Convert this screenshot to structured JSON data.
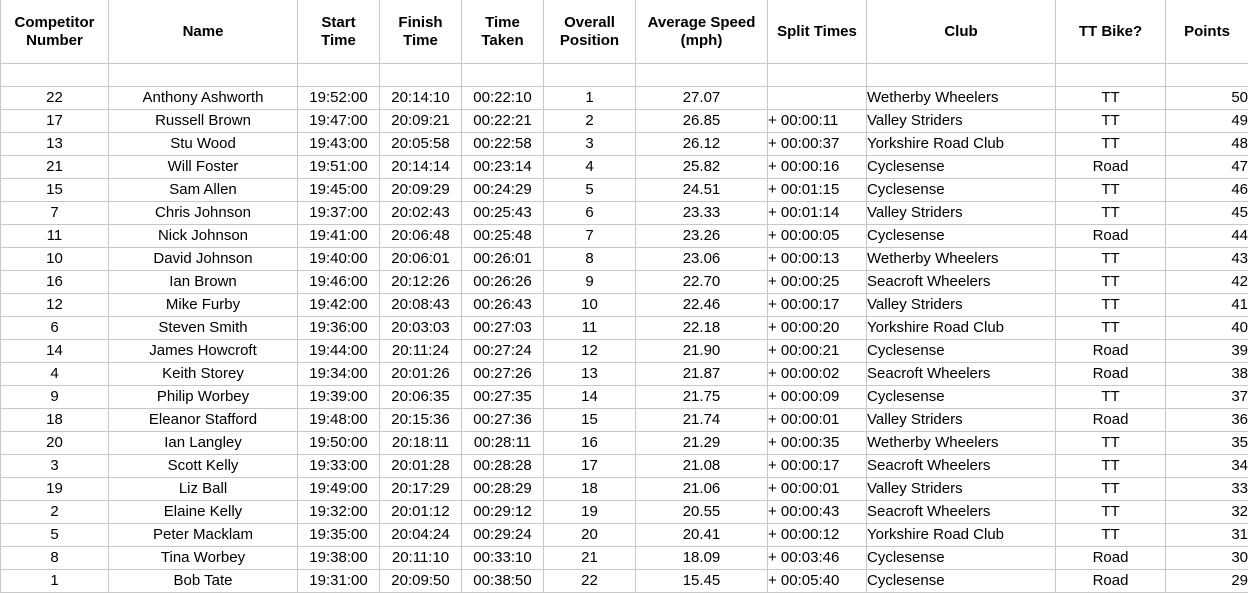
{
  "table": {
    "columns": [
      {
        "id": "competitor_number",
        "lines": [
          "Competitor",
          "Number"
        ]
      },
      {
        "id": "name",
        "lines": [
          "Name"
        ]
      },
      {
        "id": "start_time",
        "lines": [
          "Start",
          "Time"
        ]
      },
      {
        "id": "finish_time",
        "lines": [
          "Finish",
          "Time"
        ]
      },
      {
        "id": "time_taken",
        "lines": [
          "Time",
          "Taken"
        ]
      },
      {
        "id": "overall_position",
        "lines": [
          "Overall",
          "Position"
        ]
      },
      {
        "id": "average_speed",
        "lines": [
          "Average Speed",
          "(mph)"
        ]
      },
      {
        "id": "split_times",
        "lines": [
          "Split Times"
        ]
      },
      {
        "id": "club",
        "lines": [
          "Club"
        ]
      },
      {
        "id": "tt_bike",
        "lines": [
          "TT Bike?"
        ]
      },
      {
        "id": "points",
        "lines": [
          "Points"
        ]
      }
    ],
    "header": {
      "competitor_number_l1": "Competitor",
      "competitor_number_l2": "Number",
      "name": "Name",
      "start_time_l1": "Start",
      "start_time_l2": "Time",
      "finish_time_l1": "Finish",
      "finish_time_l2": "Time",
      "time_taken_l1": "Time",
      "time_taken_l2": "Taken",
      "overall_position_l1": "Overall",
      "overall_position_l2": "Position",
      "average_speed_l1": "Average Speed",
      "average_speed_l2": "(mph)",
      "split_times": "Split Times",
      "club": "Club",
      "tt_bike": "TT Bike?",
      "points": "Points"
    },
    "rows": [
      {
        "competitor_number": "22",
        "name": "Anthony Ashworth",
        "start_time": "19:52:00",
        "finish_time": "20:14:10",
        "time_taken": "00:22:10",
        "overall_position": "1",
        "average_speed": "27.07",
        "split_times": "",
        "club": "Wetherby Wheelers",
        "tt_bike": "TT",
        "points": "50"
      },
      {
        "competitor_number": "17",
        "name": "Russell Brown",
        "start_time": "19:47:00",
        "finish_time": "20:09:21",
        "time_taken": "00:22:21",
        "overall_position": "2",
        "average_speed": "26.85",
        "split_times": "+ 00:00:11",
        "club": "Valley Striders",
        "tt_bike": "TT",
        "points": "49"
      },
      {
        "competitor_number": "13",
        "name": "Stu Wood",
        "start_time": "19:43:00",
        "finish_time": "20:05:58",
        "time_taken": "00:22:58",
        "overall_position": "3",
        "average_speed": "26.12",
        "split_times": "+ 00:00:37",
        "club": "Yorkshire Road Club",
        "tt_bike": "TT",
        "points": "48"
      },
      {
        "competitor_number": "21",
        "name": "Will Foster",
        "start_time": "19:51:00",
        "finish_time": "20:14:14",
        "time_taken": "00:23:14",
        "overall_position": "4",
        "average_speed": "25.82",
        "split_times": "+ 00:00:16",
        "club": "Cyclesense",
        "tt_bike": "Road",
        "points": "47"
      },
      {
        "competitor_number": "15",
        "name": "Sam Allen",
        "start_time": "19:45:00",
        "finish_time": "20:09:29",
        "time_taken": "00:24:29",
        "overall_position": "5",
        "average_speed": "24.51",
        "split_times": "+ 00:01:15",
        "club": "Cyclesense",
        "tt_bike": "TT",
        "points": "46"
      },
      {
        "competitor_number": "7",
        "name": "Chris Johnson",
        "start_time": "19:37:00",
        "finish_time": "20:02:43",
        "time_taken": "00:25:43",
        "overall_position": "6",
        "average_speed": "23.33",
        "split_times": "+ 00:01:14",
        "club": "Valley Striders",
        "tt_bike": "TT",
        "points": "45"
      },
      {
        "competitor_number": "11",
        "name": "Nick Johnson",
        "start_time": "19:41:00",
        "finish_time": "20:06:48",
        "time_taken": "00:25:48",
        "overall_position": "7",
        "average_speed": "23.26",
        "split_times": "+ 00:00:05",
        "club": "Cyclesense",
        "tt_bike": "Road",
        "points": "44"
      },
      {
        "competitor_number": "10",
        "name": "David Johnson",
        "start_time": "19:40:00",
        "finish_time": "20:06:01",
        "time_taken": "00:26:01",
        "overall_position": "8",
        "average_speed": "23.06",
        "split_times": "+ 00:00:13",
        "club": "Wetherby Wheelers",
        "tt_bike": "TT",
        "points": "43"
      },
      {
        "competitor_number": "16",
        "name": "Ian Brown",
        "start_time": "19:46:00",
        "finish_time": "20:12:26",
        "time_taken": "00:26:26",
        "overall_position": "9",
        "average_speed": "22.70",
        "split_times": "+ 00:00:25",
        "club": "Seacroft Wheelers",
        "tt_bike": "TT",
        "points": "42"
      },
      {
        "competitor_number": "12",
        "name": "Mike Furby",
        "start_time": "19:42:00",
        "finish_time": "20:08:43",
        "time_taken": "00:26:43",
        "overall_position": "10",
        "average_speed": "22.46",
        "split_times": "+ 00:00:17",
        "club": "Valley Striders",
        "tt_bike": "TT",
        "points": "41"
      },
      {
        "competitor_number": "6",
        "name": "Steven Smith",
        "start_time": "19:36:00",
        "finish_time": "20:03:03",
        "time_taken": "00:27:03",
        "overall_position": "11",
        "average_speed": "22.18",
        "split_times": "+ 00:00:20",
        "club": "Yorkshire Road Club",
        "tt_bike": "TT",
        "points": "40"
      },
      {
        "competitor_number": "14",
        "name": "James Howcroft",
        "start_time": "19:44:00",
        "finish_time": "20:11:24",
        "time_taken": "00:27:24",
        "overall_position": "12",
        "average_speed": "21.90",
        "split_times": "+ 00:00:21",
        "club": "Cyclesense",
        "tt_bike": "Road",
        "points": "39"
      },
      {
        "competitor_number": "4",
        "name": "Keith Storey",
        "start_time": "19:34:00",
        "finish_time": "20:01:26",
        "time_taken": "00:27:26",
        "overall_position": "13",
        "average_speed": "21.87",
        "split_times": "+ 00:00:02",
        "club": "Seacroft Wheelers",
        "tt_bike": "Road",
        "points": "38"
      },
      {
        "competitor_number": "9",
        "name": "Philip Worbey",
        "start_time": "19:39:00",
        "finish_time": "20:06:35",
        "time_taken": "00:27:35",
        "overall_position": "14",
        "average_speed": "21.75",
        "split_times": "+ 00:00:09",
        "club": "Cyclesense",
        "tt_bike": "TT",
        "points": "37"
      },
      {
        "competitor_number": "18",
        "name": "Eleanor Stafford",
        "start_time": "19:48:00",
        "finish_time": "20:15:36",
        "time_taken": "00:27:36",
        "overall_position": "15",
        "average_speed": "21.74",
        "split_times": "+ 00:00:01",
        "club": "Valley Striders",
        "tt_bike": "Road",
        "points": "36"
      },
      {
        "competitor_number": "20",
        "name": "Ian Langley",
        "start_time": "19:50:00",
        "finish_time": "20:18:11",
        "time_taken": "00:28:11",
        "overall_position": "16",
        "average_speed": "21.29",
        "split_times": "+ 00:00:35",
        "club": "Wetherby Wheelers",
        "tt_bike": "TT",
        "points": "35"
      },
      {
        "competitor_number": "3",
        "name": "Scott Kelly",
        "start_time": "19:33:00",
        "finish_time": "20:01:28",
        "time_taken": "00:28:28",
        "overall_position": "17",
        "average_speed": "21.08",
        "split_times": "+ 00:00:17",
        "club": "Seacroft Wheelers",
        "tt_bike": "TT",
        "points": "34"
      },
      {
        "competitor_number": "19",
        "name": "Liz Ball",
        "start_time": "19:49:00",
        "finish_time": "20:17:29",
        "time_taken": "00:28:29",
        "overall_position": "18",
        "average_speed": "21.06",
        "split_times": "+ 00:00:01",
        "club": "Valley Striders",
        "tt_bike": "TT",
        "points": "33"
      },
      {
        "competitor_number": "2",
        "name": "Elaine Kelly",
        "start_time": "19:32:00",
        "finish_time": "20:01:12",
        "time_taken": "00:29:12",
        "overall_position": "19",
        "average_speed": "20.55",
        "split_times": "+ 00:00:43",
        "club": "Seacroft Wheelers",
        "tt_bike": "TT",
        "points": "32"
      },
      {
        "competitor_number": "5",
        "name": "Peter Macklam",
        "start_time": "19:35:00",
        "finish_time": "20:04:24",
        "time_taken": "00:29:24",
        "overall_position": "20",
        "average_speed": "20.41",
        "split_times": "+ 00:00:12",
        "club": "Yorkshire Road Club",
        "tt_bike": "TT",
        "points": "31"
      },
      {
        "competitor_number": "8",
        "name": "Tina Worbey",
        "start_time": "19:38:00",
        "finish_time": "20:11:10",
        "time_taken": "00:33:10",
        "overall_position": "21",
        "average_speed": "18.09",
        "split_times": "+ 00:03:46",
        "club": "Cyclesense",
        "tt_bike": "Road",
        "points": "30"
      },
      {
        "competitor_number": "1",
        "name": "Bob Tate",
        "start_time": "19:31:00",
        "finish_time": "20:09:50",
        "time_taken": "00:38:50",
        "overall_position": "22",
        "average_speed": "15.45",
        "split_times": "+ 00:05:40",
        "club": "Cyclesense",
        "tt_bike": "Road",
        "points": "29"
      }
    ]
  },
  "style": {
    "gridline_color": "#c8c8c8",
    "text_color": "#000000",
    "background_color": "#ffffff"
  }
}
